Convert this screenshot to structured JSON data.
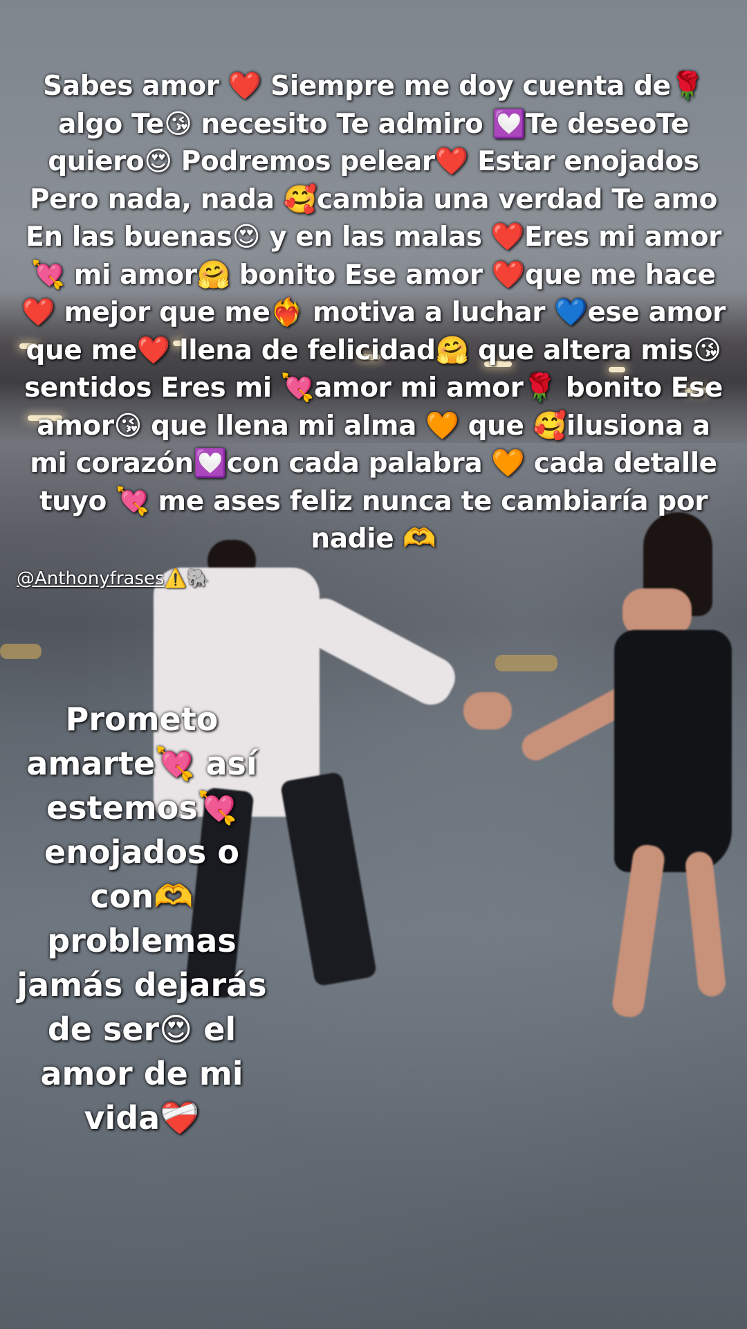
{
  "video": {
    "caption_top": "Sabes amor ❤️ Siempre me doy cuenta de🌹 algo Te😘 necesito Te admiro 💟Te deseoTe quiero😍 Podremos pelear❤️ Estar enojados Pero nada, nada 🥰cambia una verdad Te amo En las buenas😍 y en las malas ❤️Eres mi amor💘 mi amor🤗 bonito Ese amor ❤️que me hace❤️ mejor que me❤️‍🔥 motiva a luchar 💙ese amor que me❤️ llena de felicidad🤗 que altera mis😘 sentidos Eres mi 💘amor mi amor🌹 bonito Ese amor😘 que llena mi alma 🧡 que 🥰ilusiona a mi corazón💟con cada palabra 🧡 cada detalle tuyo 💘 me ases feliz nunca te cambiaría por nadie 🫶",
    "username_handle": "@Anthonyfrases",
    "username_suffix": "⚠️🐘",
    "caption_side": "Prometo amarte💘 así estemos💘 enojados o con🫶 problemas jamás dejarás de ser😍 el amor de mi vida❤️‍🩹"
  },
  "colors": {
    "caption_text": "#ffffff",
    "caption_shadow": "#000000",
    "sky": "#8b9097",
    "water": "#5d646c"
  }
}
